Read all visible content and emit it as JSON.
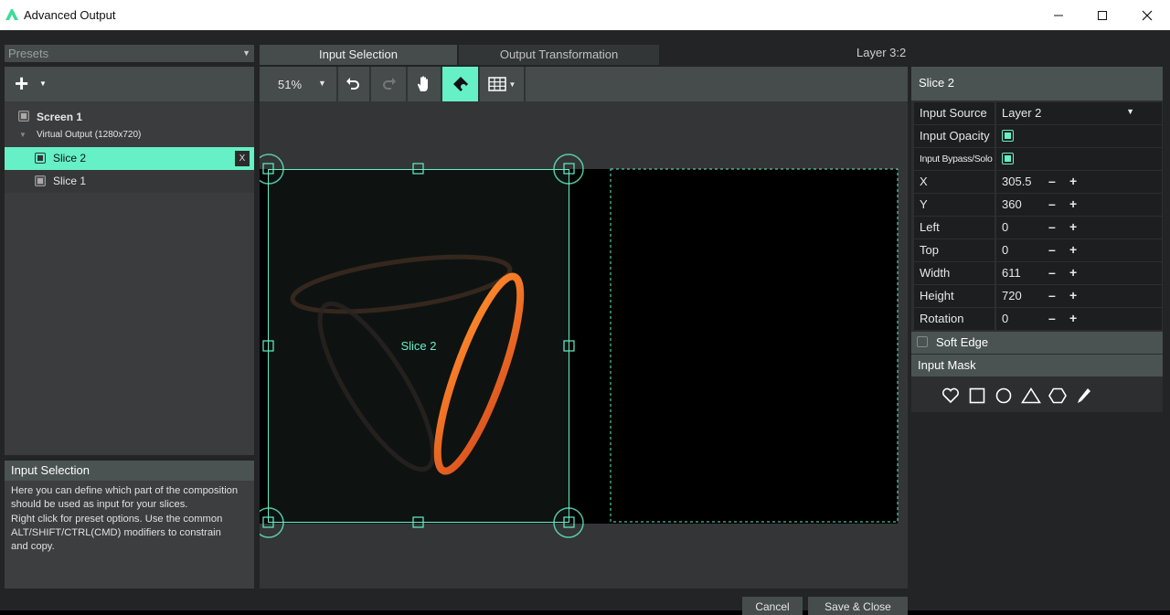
{
  "window": {
    "title": "Advanced Output",
    "controls": [
      "minimize",
      "maximize",
      "close"
    ]
  },
  "presets": {
    "value": "Presets"
  },
  "tree": {
    "screen": "Screen 1",
    "virtual_output": "Virtual Output (1280x720)",
    "slices": [
      {
        "label": "Slice 2",
        "selected": true,
        "remove_label": "X"
      },
      {
        "label": "Slice 1",
        "selected": false
      }
    ]
  },
  "help": {
    "title": "Input Selection",
    "line1": "Here you can define which part of the composition",
    "line2": "should be used as input for your slices.",
    "line3": "Right click for preset options. Use the common",
    "line4": "ALT/SHIFT/CTRL(CMD) modifiers to constrain",
    "line5": "and copy."
  },
  "tabs": [
    {
      "label": "Input Selection",
      "active": true
    },
    {
      "label": "Output Transformation",
      "active": false
    }
  ],
  "layer_label": "Layer 3:2",
  "toolbar": {
    "zoom": "51%",
    "icons": [
      "undo-icon",
      "redo-icon",
      "hand-icon",
      "snap-icon",
      "grid-icon"
    ]
  },
  "canvas": {
    "slice_label": "Slice 2"
  },
  "inspector": {
    "title": "Slice 2",
    "input_source_label": "Input Source",
    "input_source_value": "Layer 2",
    "input_opacity_label": "Input Opacity",
    "input_bypass_label": "Input Bypass/Solo",
    "fields": [
      {
        "label": "X",
        "value": "305.5"
      },
      {
        "label": "Y",
        "value": "360"
      },
      {
        "label": "Left",
        "value": "0"
      },
      {
        "label": "Top",
        "value": "0"
      },
      {
        "label": "Width",
        "value": "611"
      },
      {
        "label": "Height",
        "value": "720"
      },
      {
        "label": "Rotation",
        "value": "0"
      }
    ],
    "minus": "–",
    "plus": "+",
    "soft_edge_label": "Soft Edge",
    "input_mask_label": "Input Mask",
    "mask_icons": [
      "heart-icon",
      "square-icon",
      "circle-icon",
      "triangle-icon",
      "hexagon-icon",
      "pen-icon"
    ]
  },
  "buttons": {
    "cancel": "Cancel",
    "save": "Save & Close"
  },
  "colors": {
    "accent": "#65f0c6",
    "background": "#222426"
  }
}
